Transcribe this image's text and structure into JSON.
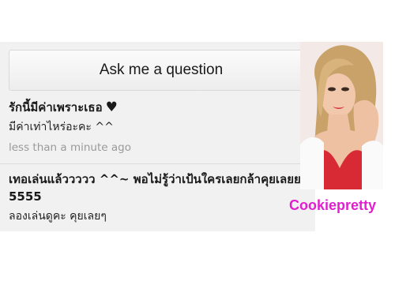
{
  "ask_button": {
    "label": "Ask me a question"
  },
  "questions": [
    {
      "title": "รักนี้มีค่าเพราะเธอ",
      "title_icon": "heart-icon",
      "answer": "มีค่าเท่าไหร่อะคะ ^^",
      "time": "less than a minute ago"
    },
    {
      "title": "เทอเล่นแล้ววววว ^^~ พอไม่รู้ว่าเป้นใครเลยกล้าคุยเลยย 5555",
      "answer": "ลองเล่นดูคะ คุยเลยๆ"
    }
  ],
  "profile": {
    "name": "Cookiepretty",
    "name_color": "#e01fcf"
  }
}
